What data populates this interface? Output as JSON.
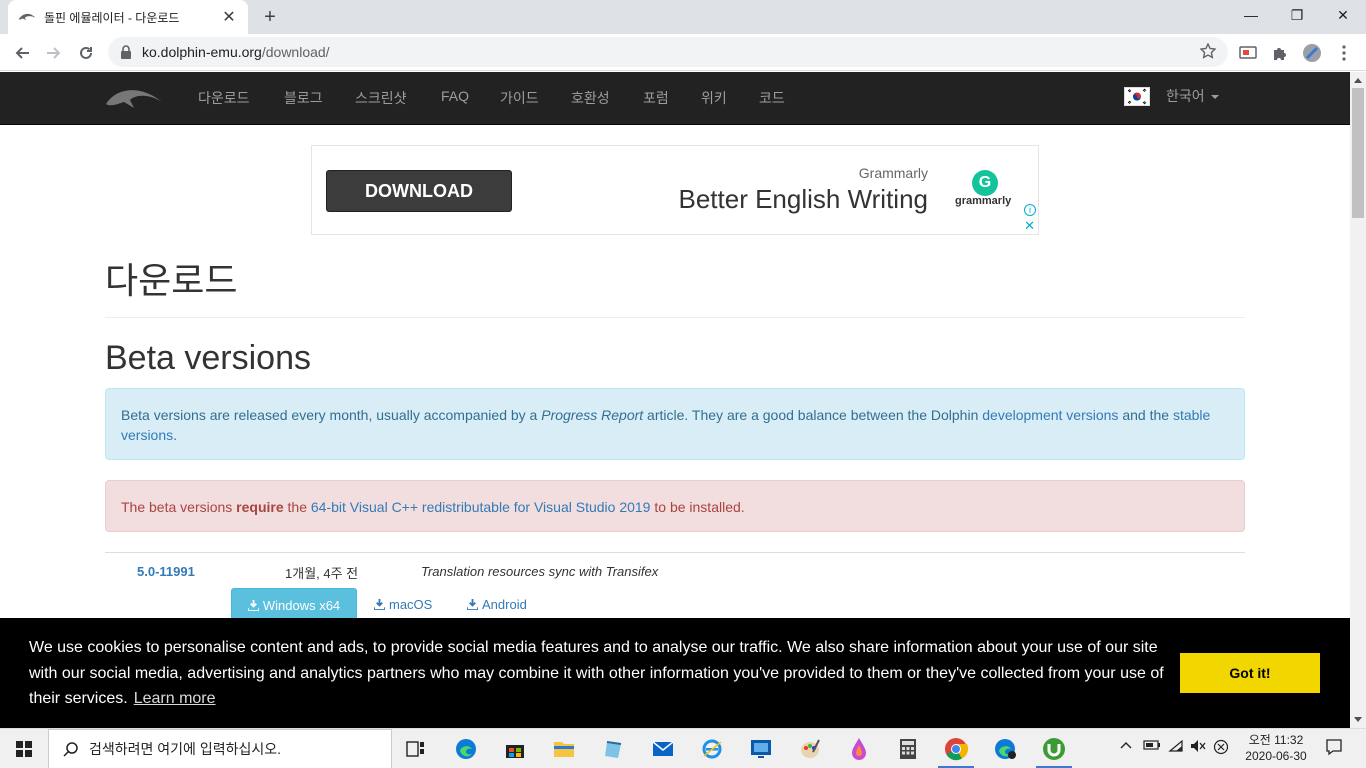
{
  "browser": {
    "tab_title": "돌핀 에뮬레이터 - 다운로드",
    "url_domain": "ko.dolphin-emu.org",
    "url_path": "/download/",
    "tab_close": "✕",
    "new_tab": "+",
    "minimize": "—",
    "restore": "❐",
    "close": "✕"
  },
  "site_nav": {
    "items": [
      "다운로드",
      "블로그",
      "스크린샷",
      "FAQ",
      "가이드",
      "호환성",
      "포럼",
      "위키",
      "코드"
    ],
    "language": "한국어"
  },
  "ad": {
    "button": "DOWNLOAD",
    "brand_small": "Grammarly",
    "headline": "Better English Writing",
    "logo_letter": "G",
    "logo_word": "grammarly",
    "info": "i",
    "close": "✕"
  },
  "page": {
    "title": "다운로드",
    "section_title": "Beta versions",
    "info_alert": {
      "text1": "Beta versions are released every month, usually accompanied by a ",
      "italic": "Progress Report",
      "text2": " article. They are a good balance between the Dolphin ",
      "link1": "development versions",
      "text3": " and the ",
      "link2": "stable versions",
      "text4": "."
    },
    "danger_alert": {
      "text1": "The beta versions ",
      "bold": "require",
      "text2": " the ",
      "link": "64-bit Visual C++ redistributable for Visual Studio 2019",
      "text3": " to be installed."
    },
    "release": {
      "version": "5.0-11991",
      "date": "1개월, 4주 전",
      "description": "Translation resources sync with Transifex",
      "dl_windows": "Windows x64",
      "dl_macos": "macOS",
      "dl_android": "Android"
    }
  },
  "cookie": {
    "message": "We use cookies to personalise content and ads, to provide social media features and to analyse our traffic. We also share information about your use of our site with our social media, advertising and analytics partners who may combine it with other information you've provided to them or they've collected from your use of their services.",
    "learn_more": "Learn more",
    "button": "Got it!"
  },
  "taskbar": {
    "search_placeholder": "검색하려면 여기에 입력하십시오.",
    "clock_time": "오전 11:32",
    "clock_date": "2020-06-30"
  },
  "colors": {
    "navbar_bg": "#222222",
    "link": "#337ab7",
    "info_bg": "#d9edf7",
    "danger_bg": "#f2dede",
    "cookie_button": "#f1d600",
    "download_button": "#5bc0de"
  }
}
